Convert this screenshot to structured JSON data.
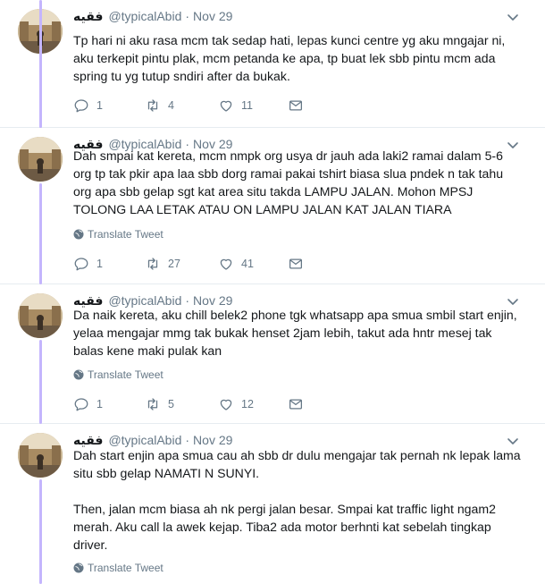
{
  "tweets": [
    {
      "author": {
        "name": "فقيه",
        "handle": "@typicalAbid",
        "date": "Nov 29"
      },
      "paragraphs": [
        "Tp hari ni aku rasa mcm tak sedap hati, lepas kunci centre yg aku mngajar ni, aku terkepit pintu plak, mcm petanda ke apa, tp buat lek sbb pintu mcm ada spring tu yg tutup sndiri after da bukak."
      ],
      "translate": "",
      "stats": {
        "replies": "1",
        "retweets": "4",
        "likes": "11"
      }
    },
    {
      "author": {
        "name": "فقيه",
        "handle": "@typicalAbid",
        "date": "Nov 29"
      },
      "paragraphs": [
        "Dah smpai kat kereta, mcm nmpk org usya dr jauh ada laki2 ramai dalam 5-6 org tp tak pkir apa laa sbb dorg ramai pakai tshirt biasa slua pndek n tak tahu org apa sbb gelap sgt kat area situ takda LAMPU JALAN. Mohon MPSJ TOLONG LAA LETAK ATAU ON LAMPU JALAN KAT JALAN TIARA"
      ],
      "translate": "Translate Tweet",
      "stats": {
        "replies": "1",
        "retweets": "27",
        "likes": "41"
      }
    },
    {
      "author": {
        "name": "فقيه",
        "handle": "@typicalAbid",
        "date": "Nov 29"
      },
      "paragraphs": [
        "Da naik kereta, aku chill belek2 phone tgk whatsapp apa smua smbil start enjin, yelaa mengajar mmg tak bukak henset 2jam lebih, takut ada hntr mesej tak balas kene maki pulak kan"
      ],
      "translate": "Translate Tweet",
      "stats": {
        "replies": "1",
        "retweets": "5",
        "likes": "12"
      }
    },
    {
      "author": {
        "name": "فقيه",
        "handle": "@typicalAbid",
        "date": "Nov 29"
      },
      "paragraphs": [
        "Dah start enjin apa smua cau ah sbb dr dulu mengajar tak pernah nk lepak lama situ sbb gelap NAMATI N SUNYI.",
        "Then, jalan mcm biasa ah nk pergi jalan besar. Smpai kat traffic light ngam2 merah. Aku call la awek kejap. Tiba2 ada motor berhnti kat sebelah tingkap driver."
      ],
      "translate": "Translate Tweet",
      "stats": null
    }
  ],
  "colors": {
    "thread_line": "#c4b5fd",
    "text": "#14171a",
    "muted": "#657786"
  },
  "icons": [
    "reply-icon",
    "retweet-icon",
    "like-icon",
    "dm-icon",
    "caret-down-icon",
    "globe-icon"
  ]
}
